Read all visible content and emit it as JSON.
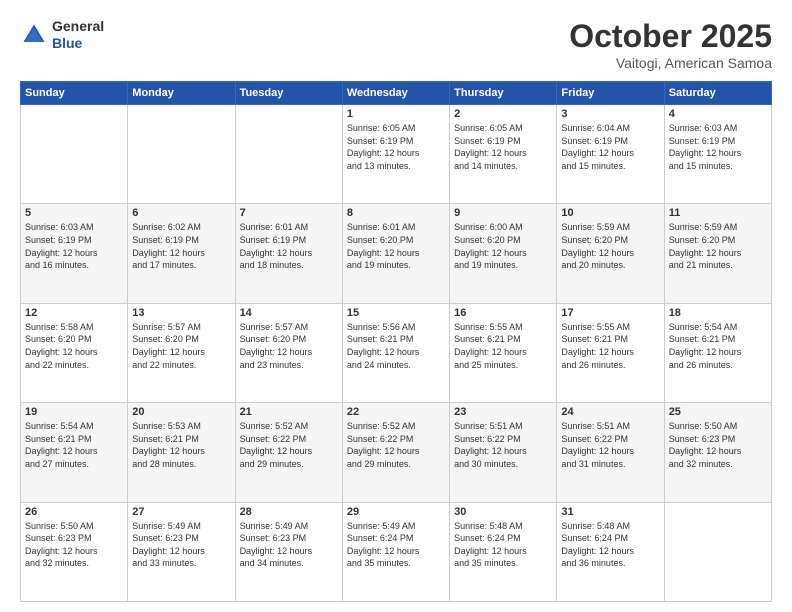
{
  "header": {
    "logo": {
      "line1": "General",
      "line2": "Blue"
    },
    "title": "October 2025",
    "location": "Vaitogi, American Samoa"
  },
  "weekdays": [
    "Sunday",
    "Monday",
    "Tuesday",
    "Wednesday",
    "Thursday",
    "Friday",
    "Saturday"
  ],
  "weeks": [
    [
      {
        "day": "",
        "info": ""
      },
      {
        "day": "",
        "info": ""
      },
      {
        "day": "",
        "info": ""
      },
      {
        "day": "1",
        "info": "Sunrise: 6:05 AM\nSunset: 6:19 PM\nDaylight: 12 hours\nand 13 minutes."
      },
      {
        "day": "2",
        "info": "Sunrise: 6:05 AM\nSunset: 6:19 PM\nDaylight: 12 hours\nand 14 minutes."
      },
      {
        "day": "3",
        "info": "Sunrise: 6:04 AM\nSunset: 6:19 PM\nDaylight: 12 hours\nand 15 minutes."
      },
      {
        "day": "4",
        "info": "Sunrise: 6:03 AM\nSunset: 6:19 PM\nDaylight: 12 hours\nand 15 minutes."
      }
    ],
    [
      {
        "day": "5",
        "info": "Sunrise: 6:03 AM\nSunset: 6:19 PM\nDaylight: 12 hours\nand 16 minutes."
      },
      {
        "day": "6",
        "info": "Sunrise: 6:02 AM\nSunset: 6:19 PM\nDaylight: 12 hours\nand 17 minutes."
      },
      {
        "day": "7",
        "info": "Sunrise: 6:01 AM\nSunset: 6:19 PM\nDaylight: 12 hours\nand 18 minutes."
      },
      {
        "day": "8",
        "info": "Sunrise: 6:01 AM\nSunset: 6:20 PM\nDaylight: 12 hours\nand 19 minutes."
      },
      {
        "day": "9",
        "info": "Sunrise: 6:00 AM\nSunset: 6:20 PM\nDaylight: 12 hours\nand 19 minutes."
      },
      {
        "day": "10",
        "info": "Sunrise: 5:59 AM\nSunset: 6:20 PM\nDaylight: 12 hours\nand 20 minutes."
      },
      {
        "day": "11",
        "info": "Sunrise: 5:59 AM\nSunset: 6:20 PM\nDaylight: 12 hours\nand 21 minutes."
      }
    ],
    [
      {
        "day": "12",
        "info": "Sunrise: 5:58 AM\nSunset: 6:20 PM\nDaylight: 12 hours\nand 22 minutes."
      },
      {
        "day": "13",
        "info": "Sunrise: 5:57 AM\nSunset: 6:20 PM\nDaylight: 12 hours\nand 22 minutes."
      },
      {
        "day": "14",
        "info": "Sunrise: 5:57 AM\nSunset: 6:20 PM\nDaylight: 12 hours\nand 23 minutes."
      },
      {
        "day": "15",
        "info": "Sunrise: 5:56 AM\nSunset: 6:21 PM\nDaylight: 12 hours\nand 24 minutes."
      },
      {
        "day": "16",
        "info": "Sunrise: 5:55 AM\nSunset: 6:21 PM\nDaylight: 12 hours\nand 25 minutes."
      },
      {
        "day": "17",
        "info": "Sunrise: 5:55 AM\nSunset: 6:21 PM\nDaylight: 12 hours\nand 26 minutes."
      },
      {
        "day": "18",
        "info": "Sunrise: 5:54 AM\nSunset: 6:21 PM\nDaylight: 12 hours\nand 26 minutes."
      }
    ],
    [
      {
        "day": "19",
        "info": "Sunrise: 5:54 AM\nSunset: 6:21 PM\nDaylight: 12 hours\nand 27 minutes."
      },
      {
        "day": "20",
        "info": "Sunrise: 5:53 AM\nSunset: 6:21 PM\nDaylight: 12 hours\nand 28 minutes."
      },
      {
        "day": "21",
        "info": "Sunrise: 5:52 AM\nSunset: 6:22 PM\nDaylight: 12 hours\nand 29 minutes."
      },
      {
        "day": "22",
        "info": "Sunrise: 5:52 AM\nSunset: 6:22 PM\nDaylight: 12 hours\nand 29 minutes."
      },
      {
        "day": "23",
        "info": "Sunrise: 5:51 AM\nSunset: 6:22 PM\nDaylight: 12 hours\nand 30 minutes."
      },
      {
        "day": "24",
        "info": "Sunrise: 5:51 AM\nSunset: 6:22 PM\nDaylight: 12 hours\nand 31 minutes."
      },
      {
        "day": "25",
        "info": "Sunrise: 5:50 AM\nSunset: 6:23 PM\nDaylight: 12 hours\nand 32 minutes."
      }
    ],
    [
      {
        "day": "26",
        "info": "Sunrise: 5:50 AM\nSunset: 6:23 PM\nDaylight: 12 hours\nand 32 minutes."
      },
      {
        "day": "27",
        "info": "Sunrise: 5:49 AM\nSunset: 6:23 PM\nDaylight: 12 hours\nand 33 minutes."
      },
      {
        "day": "28",
        "info": "Sunrise: 5:49 AM\nSunset: 6:23 PM\nDaylight: 12 hours\nand 34 minutes."
      },
      {
        "day": "29",
        "info": "Sunrise: 5:49 AM\nSunset: 6:24 PM\nDaylight: 12 hours\nand 35 minutes."
      },
      {
        "day": "30",
        "info": "Sunrise: 5:48 AM\nSunset: 6:24 PM\nDaylight: 12 hours\nand 35 minutes."
      },
      {
        "day": "31",
        "info": "Sunrise: 5:48 AM\nSunset: 6:24 PM\nDaylight: 12 hours\nand 36 minutes."
      },
      {
        "day": "",
        "info": ""
      }
    ]
  ]
}
